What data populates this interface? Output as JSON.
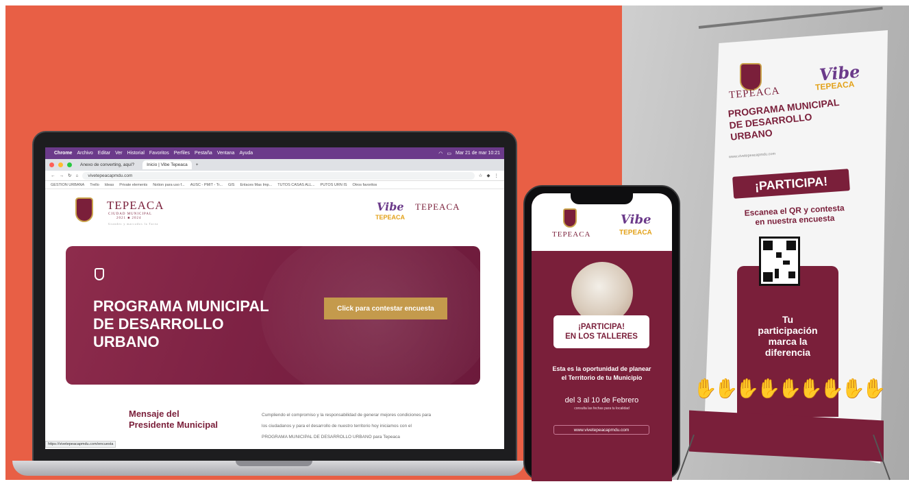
{
  "colors": {
    "brand": "#7a1f3a",
    "accent": "#c49a4c",
    "background_left": "#e85f45",
    "background_right": "#bdbdbd",
    "menubar": "#6b3a8a"
  },
  "laptop": {
    "menubar": {
      "apple": "",
      "app": "Chrome",
      "items": [
        "Archivo",
        "Editar",
        "Ver",
        "Historial",
        "Favoritos",
        "Perfiles",
        "Pestaña",
        "Ventana",
        "Ayuda"
      ],
      "clock": "Mar 21 de mar 10:21"
    },
    "tabs": [
      {
        "label": "Anexo de converting, aquí?",
        "active": false
      },
      {
        "label": "Inicio | Vibe Tepeaca",
        "active": true
      }
    ],
    "address": "vivetepeacapmdu.com",
    "bookmarks": [
      "GESTION URBANA",
      "Trello",
      "Ideas",
      "Private elements",
      "Notion para uso f...",
      "AUSC - PMIT - Tr...",
      "GIS",
      "Enlaces Mas Imp...",
      "TUTOS CASAS ALL...",
      "PUTOS URN IS",
      "Otros favoritos"
    ],
    "site": {
      "logo_name": "TEPEACA",
      "logo_sub": "CIUDAD MUNICIPAL",
      "logo_years": "2021 ■ 2024",
      "logo_slogan": "Grandes y marcados la Tarea",
      "vibe": "Vibe",
      "vibe_town": "TEPEACA",
      "right_logo": "TEPEACA",
      "hero_title": "PROGRAMA MUNICIPAL\nDE DESARROLLO\nURBANO",
      "survey_button": "Click para contestar encuesta",
      "message_title": "Mensaje del\nPresidente Municipal",
      "message_body": "Cumpliendo el compromiso y la responsabilidad de generar mejores condiciones para los ciudadanos y para el desarrollo de nuestro territorio hoy iniciamos con el PROGRAMA MUNICIPAL DE DESARROLLO URBANO para Tepeaca",
      "status_url": "https://vivetepeacapmdu.com/encuesta"
    }
  },
  "phone": {
    "logo_name": "TEPEACA",
    "vibe": "Vibe",
    "vibe_town": "TEPEACA",
    "badge_line1": "¡PARTICIPA!",
    "badge_line2": "EN LOS TALLERES",
    "headline": "Esta es la oportunidad de planear\nel Territorio de tu Municipio",
    "dates": "del 3 al 10 de Febrero",
    "dates_sub": "consulta las fechas para tu localidad",
    "url": "www.vivetepeacapmdu.com"
  },
  "banner": {
    "logo_name": "TEPEACA",
    "vibe": "Vibe",
    "vibe_town": "TEPEACA",
    "title": "PROGRAMA MUNICIPAL\nDE DESARROLLO\nURBANO",
    "url": "www.vivetepeacapmdu.com",
    "participa": "¡PARTICIPA!",
    "qr_text": "Escanea el QR y contesta\nen nuestra encuesta",
    "difference": "Tu\nparticipación\nmarca la\ndiferencia",
    "hands": "✋✋✋✋✋✋✋✋✋✋"
  }
}
